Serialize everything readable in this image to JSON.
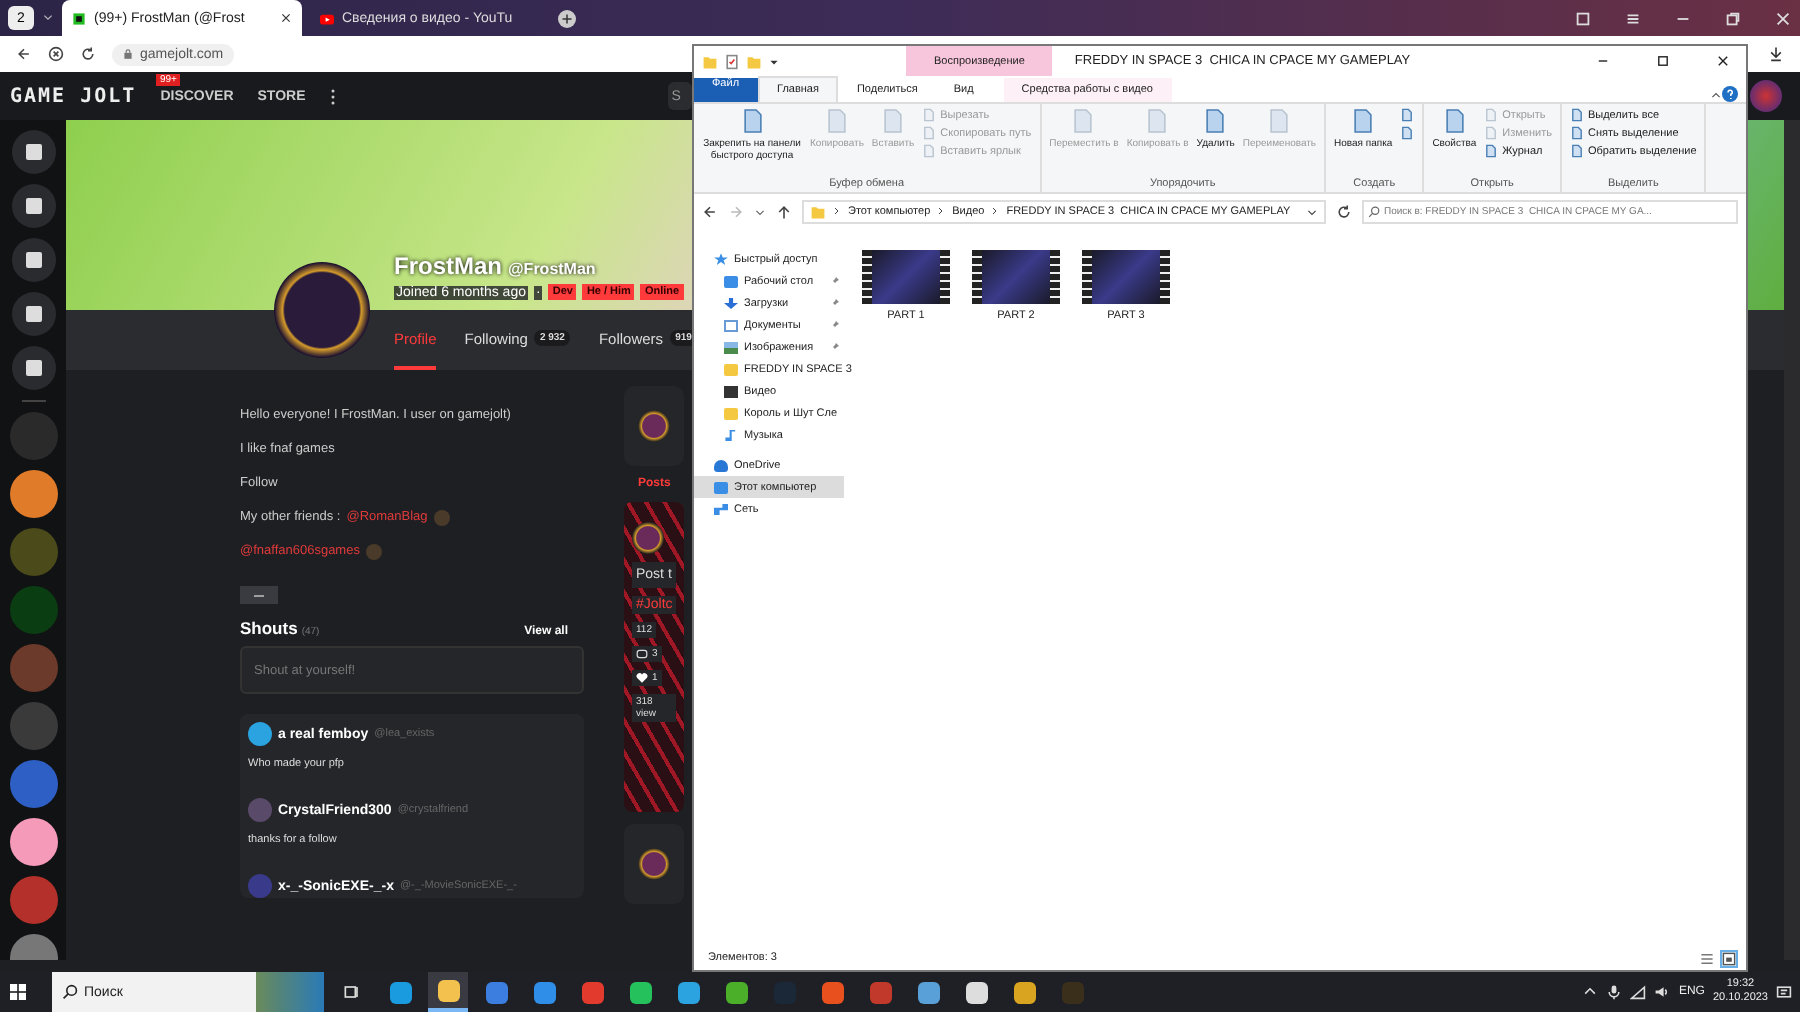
{
  "browser": {
    "workspace": "2",
    "tabs": [
      {
        "title": "(99+) FrostMan (@Frost",
        "selected": true
      },
      {
        "title": "Сведения о видео - YouTu",
        "selected": false
      }
    ],
    "address": "gamejolt.com"
  },
  "site": {
    "logo": "GAME JOLT",
    "badge": "99+",
    "nav": [
      "DISCOVER",
      "STORE"
    ],
    "search": {
      "placeholder": "S"
    },
    "profile": {
      "name": "FrostMan",
      "handle": "@FrostMan",
      "joined": "Joined 6 months ago",
      "separator": "·",
      "tags": [
        "Dev",
        "He / Him",
        "Online"
      ]
    },
    "tabs": [
      {
        "label": "Profile",
        "selected": true
      },
      {
        "label": "Following",
        "count": "2 932",
        "selected": false
      },
      {
        "label": "Followers",
        "count": "919",
        "selected": false
      }
    ],
    "bio": [
      {
        "kind": "text",
        "text": "Hello everyone! I FrostMan. I user on gamejolt)"
      },
      {
        "kind": "text",
        "text": "I like fnaf games"
      },
      {
        "kind": "text",
        "text": "Follow"
      },
      {
        "kind": "mention",
        "text": "My other friends :",
        "link": "@RomanBlag"
      },
      {
        "kind": "mention",
        "link": "@fnaffan606sgames"
      }
    ],
    "shouts": {
      "title": "Shouts",
      "count": "(47)",
      "view_all": "View all",
      "placeholder": "Shout at yourself!",
      "items": [
        {
          "name": "a real femboy",
          "handle": "@lea_exists",
          "text": "Who made your pfp"
        },
        {
          "name": "CrystalFriend300",
          "handle": "@crystalfriend",
          "text": "thanks for a follow"
        },
        {
          "name": "x-_-SonicEXE-_-x",
          "handle": "@-_-MovieSonicEXE-_-"
        }
      ]
    },
    "feed": {
      "tab": "Posts",
      "post_title": "Post t",
      "hashtag": "#Joltc",
      "small_count": "112",
      "comments": "3",
      "likes": "1",
      "views": "318 view"
    }
  },
  "explorer": {
    "context_tab": "Воспроизведение",
    "title": "FREDDY IN SPACE 3  CHICA IN CPACE MY GAMEPLAY",
    "ribbon_tabs": [
      {
        "label": "Файл",
        "kind": "file",
        "selected": false
      },
      {
        "label": "Главная",
        "kind": "tab",
        "selected": true
      },
      {
        "label": "Поделиться",
        "kind": "tab",
        "selected": false
      },
      {
        "label": "Вид",
        "kind": "tab",
        "selected": false
      },
      {
        "label": "Средства работы с видео",
        "kind": "context",
        "selected": false
      }
    ],
    "groups": [
      {
        "label": "Буфер обмена",
        "commands": [
          {
            "label": "Закрепить на панели быстрого доступа",
            "kind": "large",
            "disabled": false
          },
          {
            "label": "Копировать",
            "kind": "large",
            "disabled": true
          },
          {
            "label": "Вставить",
            "kind": "large",
            "disabled": true
          },
          {
            "label": "Вырезать",
            "kind": "small",
            "disabled": true
          },
          {
            "label": "Скопировать путь",
            "kind": "small",
            "disabled": true
          },
          {
            "label": "Вставить ярлык",
            "kind": "small",
            "disabled": true
          }
        ]
      },
      {
        "label": "Упорядочить",
        "commands": [
          {
            "label": "Переместить в",
            "kind": "large",
            "disabled": true
          },
          {
            "label": "Копировать в",
            "kind": "large",
            "disabled": true
          },
          {
            "label": "Удалить",
            "kind": "large",
            "disabled": false
          },
          {
            "label": "Переименовать",
            "kind": "large",
            "disabled": true
          }
        ]
      },
      {
        "label": "Создать",
        "commands": [
          {
            "label": "Новая папка",
            "kind": "large",
            "disabled": false
          },
          {
            "kind": "icon",
            "disabled": false
          },
          {
            "kind": "icon",
            "disabled": false
          }
        ]
      },
      {
        "label": "Открыть",
        "commands": [
          {
            "label": "Свойства",
            "kind": "large",
            "disabled": false
          },
          {
            "label": "Открыть",
            "kind": "small",
            "disabled": true
          },
          {
            "label": "Изменить",
            "kind": "small",
            "disabled": true
          },
          {
            "label": "Журнал",
            "kind": "small",
            "disabled": false
          }
        ]
      },
      {
        "label": "Выделить",
        "commands": [
          {
            "label": "Выделить все",
            "kind": "small",
            "disabled": false
          },
          {
            "label": "Снять выделение",
            "kind": "small",
            "disabled": false
          },
          {
            "label": "Обратить выделение",
            "kind": "small",
            "disabled": false
          }
        ]
      }
    ],
    "path": [
      "Этот компьютер",
      "Видео",
      "FREDDY IN SPACE 3  CHICA IN CPACE MY GAMEPLAY"
    ],
    "search": {
      "placeholder": "Поиск в: FREDDY IN SPACE 3  CHICA IN CPACE MY GA..."
    },
    "nav": [
      {
        "label": "Быстрый доступ",
        "kind": "star",
        "selected": false,
        "children": [
          {
            "label": "Рабочий стол",
            "kind": "desktop",
            "pinned": true,
            "selected": false
          },
          {
            "label": "Загрузки",
            "kind": "download",
            "pinned": true,
            "selected": false
          },
          {
            "label": "Документы",
            "kind": "document",
            "pinned": true,
            "selected": false
          },
          {
            "label": "Изображения",
            "kind": "image",
            "pinned": true,
            "selected": false
          },
          {
            "label": "FREDDY IN SPACE 3",
            "kind": "folder",
            "pinned": false,
            "selected": false
          },
          {
            "label": "Видео",
            "kind": "video",
            "pinned": false,
            "selected": false
          },
          {
            "label": "Король и Шут Сле",
            "kind": "folder",
            "pinned": false,
            "selected": false
          },
          {
            "label": "Музыка",
            "kind": "music",
            "pinned": false,
            "selected": false
          }
        ]
      },
      {
        "label": "OneDrive",
        "kind": "cloud",
        "selected": false
      },
      {
        "label": "Этот компьютер",
        "kind": "computer",
        "selected": true
      },
      {
        "label": "Сеть",
        "kind": "network",
        "selected": false
      }
    ],
    "files": [
      {
        "name": "PART 1"
      },
      {
        "name": "PART 2"
      },
      {
        "name": "PART 3"
      }
    ],
    "status": "Элементов: 3",
    "views": [
      {
        "kind": "details",
        "selected": false
      },
      {
        "kind": "tiles",
        "selected": true
      }
    ]
  },
  "taskbar": {
    "search": {
      "placeholder": "Поиск"
    },
    "apps": [
      {
        "active": false
      },
      {
        "active": true
      },
      {
        "active": false
      },
      {
        "active": false
      },
      {
        "active": false
      },
      {
        "active": false
      },
      {
        "active": false
      },
      {
        "active": false
      },
      {
        "active": false
      },
      {
        "active": false
      },
      {
        "active": false
      },
      {
        "active": false
      },
      {
        "active": false
      },
      {
        "active": false
      },
      {
        "active": false
      }
    ],
    "lang": "ENG",
    "time": "19:32",
    "date": "20.10.2023"
  }
}
